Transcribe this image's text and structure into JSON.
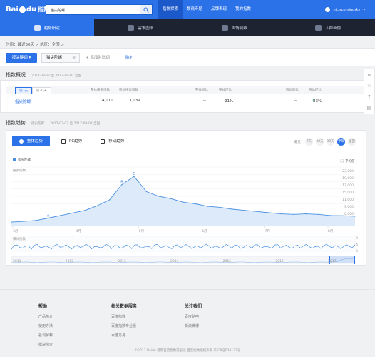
{
  "header": {
    "logo_text": "Bai",
    "logo_text_2": "du",
    "logo_sub": "指数",
    "search_value": "猫尖陀螺",
    "nav": [
      "指数探索",
      "数说专题",
      "品牌表现",
      "我的指数"
    ],
    "user_name": "niciscomingsky"
  },
  "subnav": [
    "趋势研究",
    "需求图谱",
    "舆情洞察",
    "人群画像"
  ],
  "breadcrumb": "时间：最近30天  >  地区：全国  >",
  "filters": {
    "keyword_button": "按关键词",
    "keyword": "猫尖陀螺",
    "add_compare": "+ 添加对比词",
    "confirm": "确定"
  },
  "overview": {
    "title": "指数概况",
    "dates": "2017-08-27 至 2017-09-02  全国",
    "segments": [
      "近7天",
      "近30天"
    ],
    "columns": [
      "整体搜索指数",
      "移动搜索指数",
      "整体同比",
      "整体环比",
      "移动同比",
      "移动环比"
    ],
    "row": {
      "keyword": "指尖陀螺",
      "overall": "4,010",
      "mobile": "3,039",
      "overall_yoy": "--",
      "overall_mom": "-21%",
      "mobile_yoy": "--",
      "mobile_mom": "-23%"
    }
  },
  "trend": {
    "title": "指数趋势",
    "subtitle": "指尖陀螺",
    "dates": "2017-03-07 至 2017-09-02  全国",
    "tabs": [
      "整体趋势",
      "PC趋势",
      "移动趋势"
    ],
    "range_label": "最近",
    "ranges": [
      "7天",
      "30天",
      "90天",
      "半年",
      "全部"
    ]
  },
  "footer": {
    "cols": [
      {
        "heading": "帮助",
        "links": [
          "产品简介",
          "使用方法",
          "名词解释",
          "模块简介"
        ]
      },
      {
        "heading": "相关数据服务",
        "links": [
          "百度指数",
          "百度指数专业版",
          "百度方舟"
        ]
      },
      {
        "heading": "关注我们",
        "links": [
          "百度贴吧",
          "新浪微博"
        ]
      }
    ],
    "copyright": "©2017 Baidu  使用百度指数前必读  百度指数版权声明  京ICP证030173号"
  },
  "chart_data": {
    "type": "area",
    "title": "",
    "legend": [
      "指尖陀螺"
    ],
    "legend_right": "平均值",
    "ylabel": "搜索指数",
    "x_labels": [
      "3月",
      "4月",
      "5月",
      "6月",
      "7月",
      "8月"
    ],
    "y_ticks": [
      "23,000",
      "19,000",
      "17,000",
      "15,000",
      "11,000",
      "9,000",
      "6,000",
      "4,000"
    ],
    "ylim": [
      0,
      25000
    ],
    "peak_labels": [
      "A",
      "B",
      "C"
    ],
    "x": [
      "3/7",
      "3/14",
      "3/21",
      "3/28",
      "4/4",
      "4/11",
      "4/18",
      "4/25",
      "5/2",
      "5/9",
      "5/12",
      "5/16",
      "5/20",
      "5/23",
      "5/27",
      "6/3",
      "6/10",
      "6/17",
      "6/24",
      "7/1",
      "7/8",
      "7/15",
      "7/22",
      "7/29",
      "8/5",
      "8/12",
      "8/19",
      "8/26",
      "9/2"
    ],
    "values": [
      1500,
      1800,
      2200,
      3200,
      4300,
      5400,
      6500,
      8500,
      11000,
      17500,
      21000,
      14500,
      12500,
      11500,
      10000,
      9300,
      8200,
      7800,
      7000,
      6500,
      6000,
      5500,
      5000,
      4800,
      5000,
      4800,
      4300,
      4200,
      4000
    ],
    "news_label": "媒体指数",
    "news_ticks": [
      "8",
      "4",
      "0"
    ],
    "overview_labels": [
      "2011",
      "2012",
      "2013",
      "2014",
      "2015",
      "2016",
      "2017"
    ]
  }
}
